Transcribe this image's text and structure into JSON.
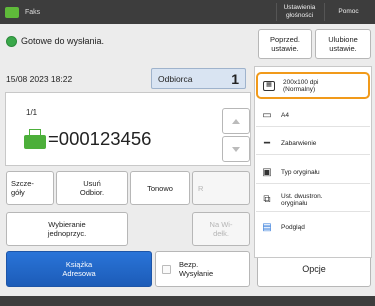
{
  "topbar": {
    "app_tab": "Faks",
    "volume_settings": "Ustawienia głośności",
    "help": "Pomoc"
  },
  "status": {
    "text": "Gotowe do wysłania."
  },
  "header_buttons": {
    "prev_settings": "Poprzed. ustawie.",
    "saved_settings": "Ulubione ustawie."
  },
  "datetime": "15/08 2023 18:22",
  "recipients": {
    "tab_label": "Odbiorca",
    "count": "1",
    "page_indicator": "1/1",
    "fax_number": "=000123456"
  },
  "action_buttons": {
    "details": "Szcze-\ngóły",
    "delete_dest": "Usuń\nOdbior.",
    "tone": "Tonowo",
    "r": "R",
    "onetouch": "Wybieranie\njednoprzyc.",
    "on_hook": "Na Wi-\ndełk.",
    "address_book": "Książka\nAdresowa",
    "direct_send": "Bezp.\nWysyłanie",
    "options": "Opcje"
  },
  "right_panel": {
    "items": [
      {
        "label": "200x100 dpi\n(Normalny)",
        "icon": "resolution-icon"
      },
      {
        "label": "A4",
        "icon": "paper-size-icon"
      },
      {
        "label": "Zabarwienie",
        "icon": "density-icon"
      },
      {
        "label": "Typ oryginału",
        "icon": "original-type-icon"
      },
      {
        "label": "Ust. dwustron.\noryginału",
        "icon": "two-sided-icon"
      },
      {
        "label": "Podgląd",
        "icon": "preview-icon"
      }
    ]
  },
  "colors": {
    "accent_blue": "#1c5cb8",
    "selected_border": "#f19a1a",
    "status_green": "#3aa84a"
  }
}
